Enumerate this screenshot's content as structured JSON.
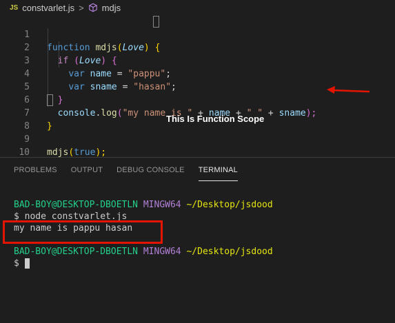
{
  "breadcrumb": {
    "file_badge": "JS",
    "file": "constvarlet.js",
    "separator": ">",
    "symbol": "mdjs"
  },
  "editor": {
    "line_numbers": [
      "1",
      "2",
      "3",
      "4",
      "5",
      "6",
      "7",
      "8",
      "9",
      "10"
    ],
    "tokens": {
      "kw_function": "function",
      "fn_mdjs": "mdjs",
      "paren_open": "(",
      "param_love": "Love",
      "paren_close": ")",
      "brace_open": "{",
      "brace_close": "}",
      "kw_if": "if",
      "kw_var": "var",
      "var_name": "name",
      "var_sname": "sname",
      "eq": " = ",
      "semi": ";",
      "str_pappu": "\"pappu\"",
      "str_hasan": "\"hasan\"",
      "console": "console",
      "dot": ".",
      "log": "log",
      "str_myname": "\"my name is \"",
      "plus": " + ",
      "str_space": "\" \"",
      "close_semi": ");",
      "kw_true": "true",
      "call_close": ");"
    }
  },
  "annotation": {
    "text": "This Is Function Scope"
  },
  "panel": {
    "tabs": [
      {
        "label": "PROBLEMS"
      },
      {
        "label": "OUTPUT"
      },
      {
        "label": "DEBUG CONSOLE"
      },
      {
        "label": "TERMINAL"
      }
    ]
  },
  "terminal": {
    "user": "BAD-BOY@DESKTOP-DBOETLN",
    "host": "MINGW64",
    "path": "~/Desktop/jsdood",
    "command": "$ node constvarlet.js",
    "output": "my name is pappu hasan",
    "prompt": "$ "
  },
  "colors": {
    "accent_red": "#e51400",
    "terminal_green": "#23d18b",
    "terminal_purple": "#b180d7",
    "terminal_yellow": "#e5e510"
  }
}
